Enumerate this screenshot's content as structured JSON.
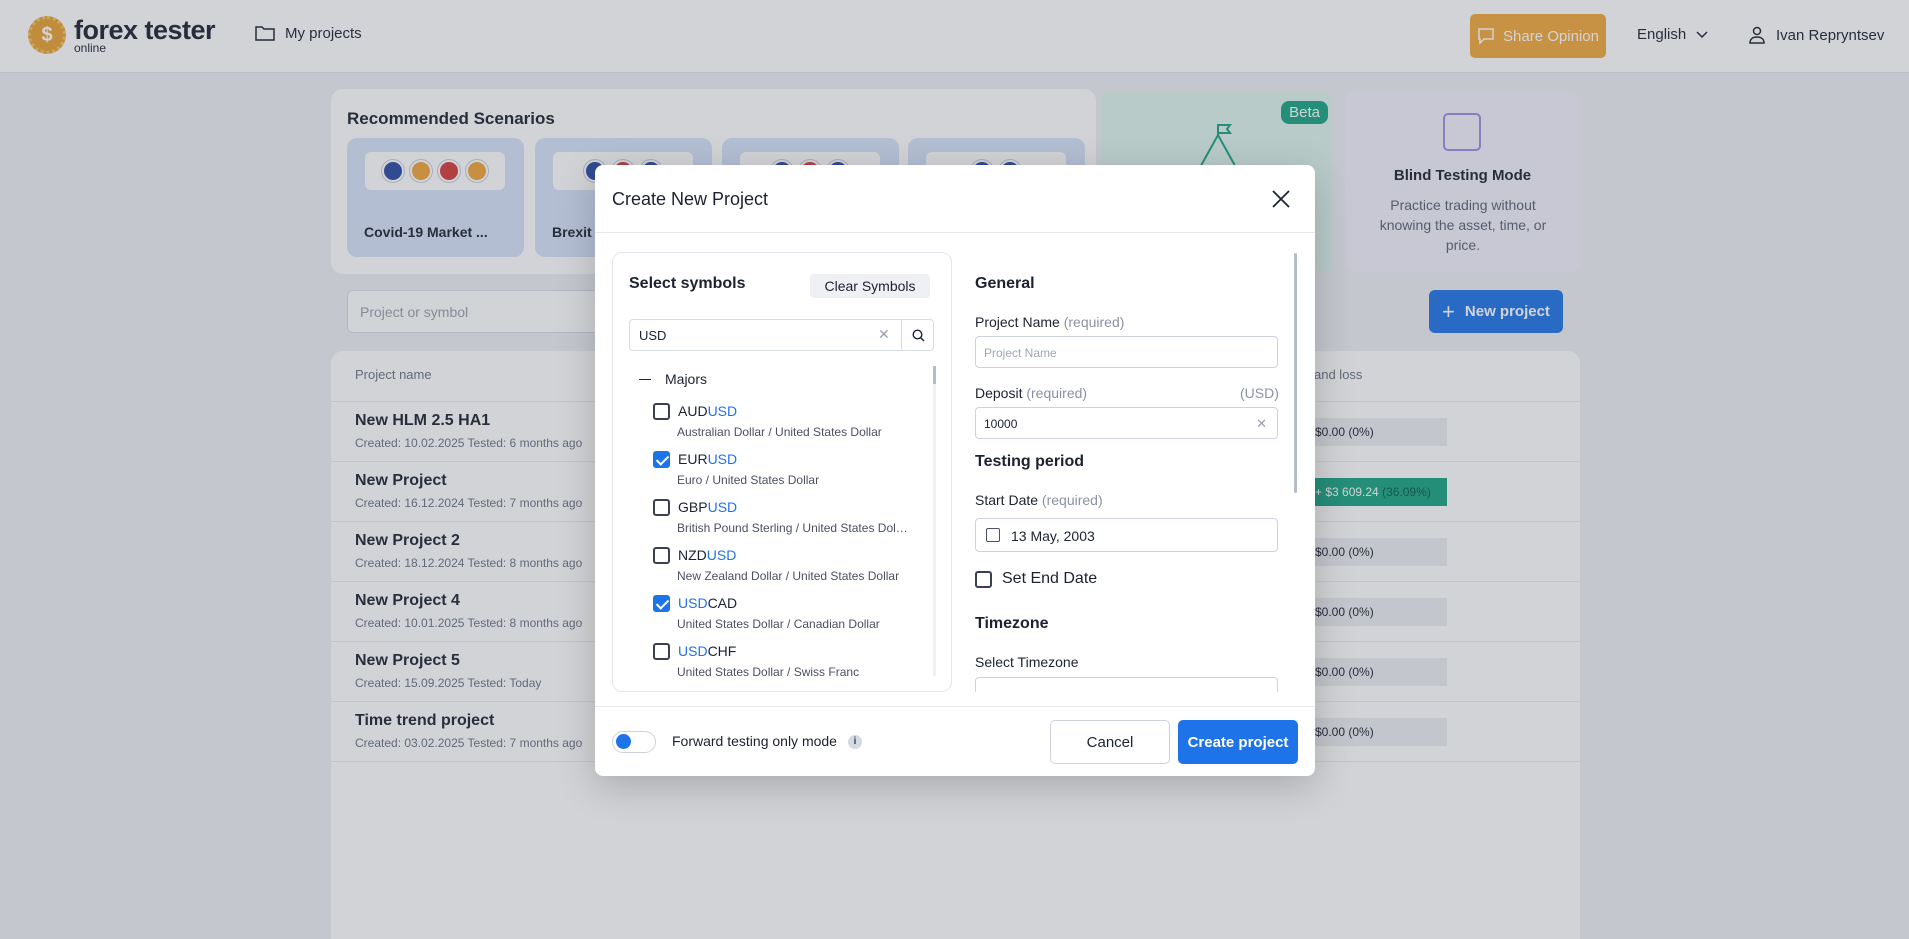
{
  "header": {
    "logo_main": "forex tester",
    "logo_sub": "online",
    "nav_projects": "My projects",
    "share_label": "Share Opinion",
    "language": "English",
    "user_name": "Ivan Repryntsev"
  },
  "recommended": {
    "title": "Recommended Scenarios",
    "scenarios": [
      {
        "name": "Covid-19 Market ..."
      },
      {
        "name": "Brexit F"
      },
      {
        "name": ""
      },
      {
        "name": ""
      }
    ]
  },
  "promo": {
    "beta_label": "Beta",
    "blind_title": "Blind Testing Mode",
    "blind_desc": "Practice trading without knowing the asset, time, or price."
  },
  "projects": {
    "search_placeholder": "Project or symbol",
    "new_project_label": "New project",
    "col_name": "Project name",
    "col_pl": "and loss",
    "rows": [
      {
        "name": "New HLM 2.5 HA1",
        "meta": "Created: 10.02.2025 Tested: 6 months ago",
        "pl": "$0.00",
        "pct": "(0%)"
      },
      {
        "name": "New Project",
        "meta": "Created: 16.12.2024 Tested: 7 months ago",
        "pl": "+ $3 609.24",
        "pct": "(36.09%)"
      },
      {
        "name": "New Project 2",
        "meta": "Created: 18.12.2024 Tested: 8 months ago",
        "pl": "$0.00",
        "pct": "(0%)"
      },
      {
        "name": "New Project 4",
        "meta": "Created: 10.01.2025 Tested: 8 months ago",
        "pl": "$0.00",
        "pct": "(0%)"
      },
      {
        "name": "New Project 5",
        "meta": "Created: 15.09.2025 Tested: Today",
        "pl": "$0.00",
        "pct": "(0%)"
      },
      {
        "name": "Time trend project",
        "meta": "Created: 03.02.2025 Tested: 7 months ago",
        "pl": "$0.00",
        "pct": "(0%)"
      }
    ]
  },
  "modal": {
    "title": "Create New Project",
    "symbols": {
      "title": "Select symbols",
      "clear_label": "Clear Symbols",
      "search_value": "USD",
      "group": "Majors",
      "items": [
        {
          "pre": "AUD",
          "hl": "USD",
          "post": "",
          "desc": "Australian Dollar / United States Dollar",
          "checked": false
        },
        {
          "pre": "EUR",
          "hl": "USD",
          "post": "",
          "desc": "Euro / United States Dollar",
          "checked": true
        },
        {
          "pre": "GBP",
          "hl": "USD",
          "post": "",
          "desc": "British Pound Sterling / United States Dollar",
          "checked": false
        },
        {
          "pre": "NZD",
          "hl": "USD",
          "post": "",
          "desc": "New Zealand Dollar / United States Dollar",
          "checked": false
        },
        {
          "pre": "",
          "hl": "USD",
          "post": "CAD",
          "desc": "United States Dollar / Canadian Dollar",
          "checked": true
        },
        {
          "pre": "",
          "hl": "USD",
          "post": "CHF",
          "desc": "United States Dollar / Swiss Franc",
          "checked": false
        }
      ]
    },
    "general": {
      "title": "General",
      "project_name_label": "Project Name",
      "required": "(required)",
      "project_name_placeholder": "Project Name",
      "deposit_label": "Deposit",
      "deposit_unit": "(USD)",
      "deposit_value": "10000",
      "testing_period_title": "Testing period",
      "start_date_label": "Start Date",
      "start_date_value": "13 May, 2003",
      "set_end_date_label": "Set End Date",
      "timezone_title": "Timezone",
      "select_timezone_label": "Select Timezone"
    },
    "footer": {
      "forward_label": "Forward testing only mode",
      "cancel_label": "Cancel",
      "create_label": "Create project"
    }
  },
  "colors": {
    "accent": "#1f73e8",
    "brand_orange": "#f2a83b",
    "profit_green": "#1aa383"
  }
}
